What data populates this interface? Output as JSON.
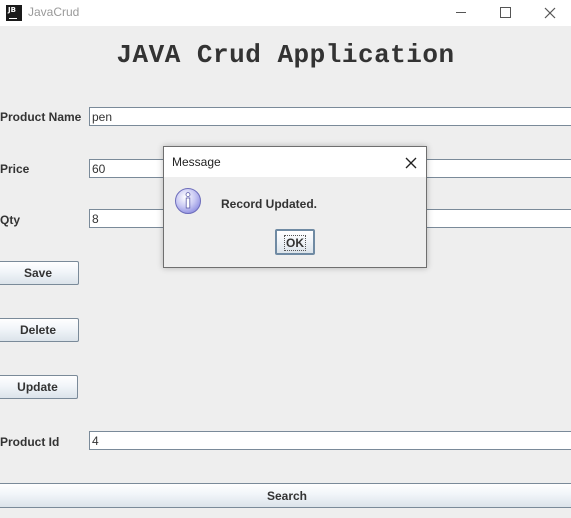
{
  "window": {
    "icon_text": "JB",
    "title": "JavaCrud"
  },
  "heading": "JAVA Crud Application",
  "form": {
    "product_name_label": "Product Name",
    "product_name_value": "pen",
    "price_label": "Price",
    "price_value": "60",
    "qty_label": "Qty",
    "qty_value": "8",
    "product_id_label": "Product Id",
    "product_id_value": "4"
  },
  "buttons": {
    "save": "Save",
    "delete": "Delete",
    "update": "Update",
    "search": "Search"
  },
  "dialog": {
    "title": "Message",
    "message": "Record Updated.",
    "ok": "OK",
    "icon": "info-icon"
  },
  "colors": {
    "background": "#eeeeee",
    "button_gradient_bottom": "#dbe3ea",
    "info_icon": "#8c8ce0"
  }
}
